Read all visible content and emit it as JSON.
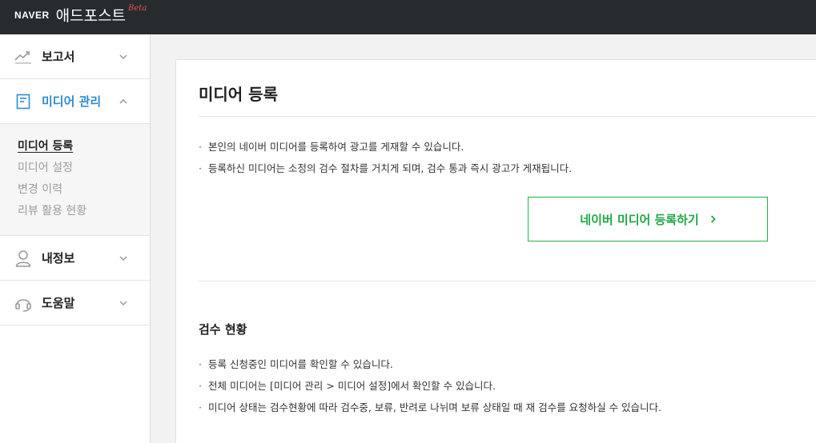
{
  "header": {
    "brand": "NAVER",
    "product": "애드포스트",
    "beta": "Beta"
  },
  "sidebar": {
    "items": [
      {
        "label": "보고서",
        "icon": "trend-line-icon"
      },
      {
        "label": "미디어 관리",
        "icon": "document-icon",
        "active": true
      },
      {
        "label": "내정보",
        "icon": "user-icon"
      },
      {
        "label": "도움말",
        "icon": "headset-icon"
      }
    ],
    "submenu": [
      {
        "label": "미디어 등록",
        "current": true
      },
      {
        "label": "미디어 설정"
      },
      {
        "label": "변경 이력"
      },
      {
        "label": "리뷰 활용 현황"
      }
    ]
  },
  "main": {
    "title": "미디어 등록",
    "intro_bullets": [
      "본인의 네이버 미디어를 등록하여 광고를 게재할 수 있습니다.",
      "등록하신 미디어는 소정의 검수 절차를 거치게 되며, 검수 통과 즉시 광고가 게재됩니다."
    ],
    "register_button": "네이버 미디어 등록하기",
    "review_title": "검수 현황",
    "review_bullets": [
      "등록 신청중인 미디어를 확인할 수 있습니다.",
      "전체 미디어는 [미디어 관리 > 미디어 설정]에서 확인할 수 있습니다.",
      "미디어 상태는 검수현황에 따라 검수중, 보류, 반려로 나뉘며 보류 상태일 때 재 검수를 요청하실 수 있습니다."
    ]
  },
  "colors": {
    "topbar": "#262b2e",
    "active_menu": "#2a8bd4",
    "register_green": "#1ea845",
    "beta_red": "#e4514b"
  }
}
